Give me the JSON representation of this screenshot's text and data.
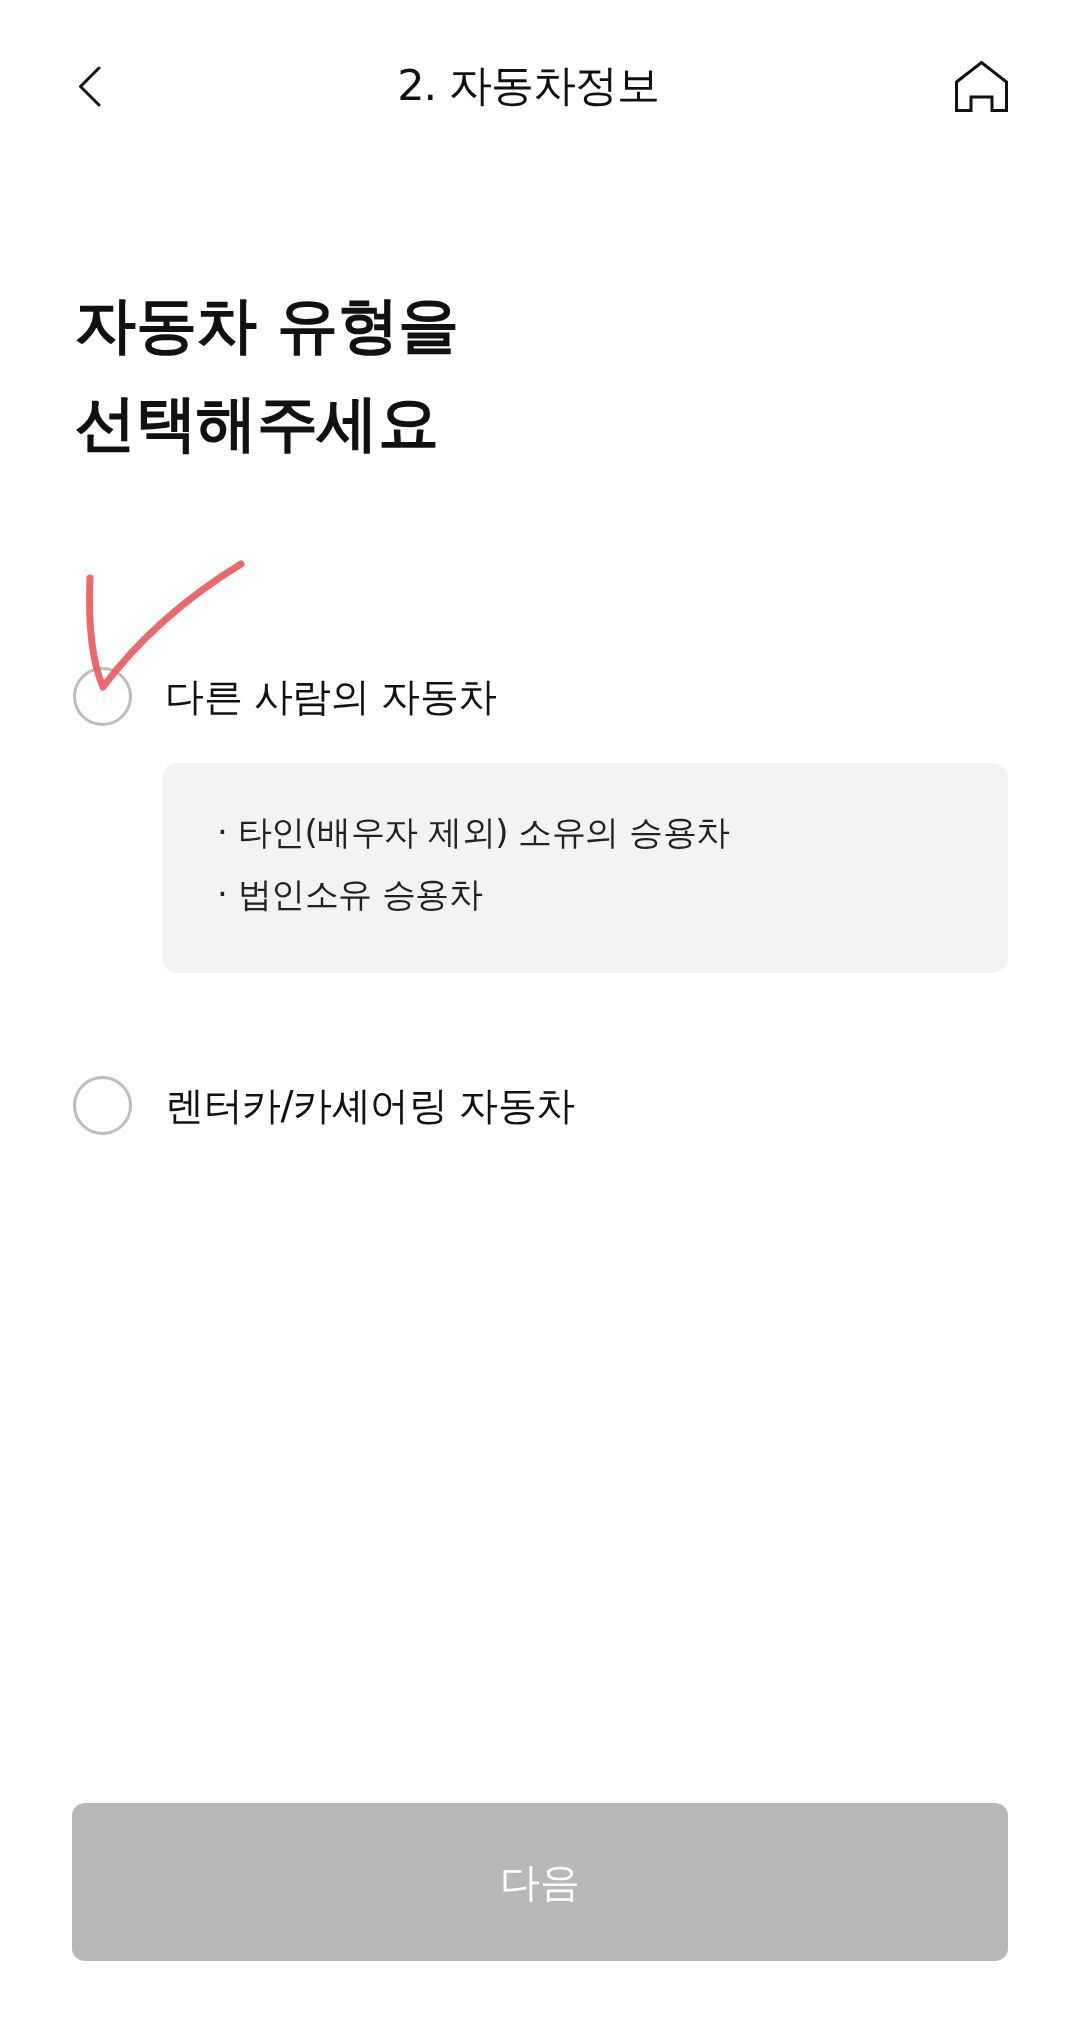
{
  "header": {
    "title": "2. 자동차정보"
  },
  "heading": "자동차 유형을\n선택해주세요",
  "options": [
    {
      "label": "다른 사람의 자동차",
      "selected": false,
      "details": [
        "· 타인(배우자 제외) 소유의 승용차",
        "· 법인소유 승용차"
      ]
    },
    {
      "label": "렌터카/카셰어링 자동차",
      "selected": false
    }
  ],
  "next_button": {
    "label": "다음",
    "disabled": true
  },
  "annotation": {
    "kind": "check"
  }
}
